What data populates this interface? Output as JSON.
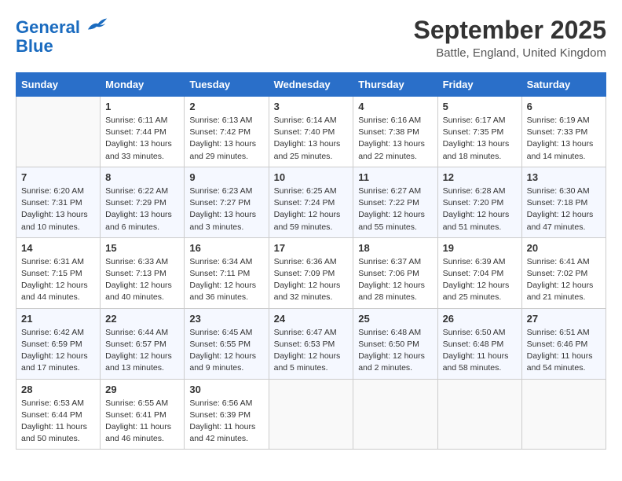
{
  "header": {
    "logo_line1": "General",
    "logo_line2": "Blue",
    "month": "September 2025",
    "location": "Battle, England, United Kingdom"
  },
  "days_of_week": [
    "Sunday",
    "Monday",
    "Tuesday",
    "Wednesday",
    "Thursday",
    "Friday",
    "Saturday"
  ],
  "weeks": [
    [
      {
        "day": "",
        "sunrise": "",
        "sunset": "",
        "daylight": ""
      },
      {
        "day": "1",
        "sunrise": "6:11 AM",
        "sunset": "7:44 PM",
        "daylight": "13 hours and 33 minutes."
      },
      {
        "day": "2",
        "sunrise": "6:13 AM",
        "sunset": "7:42 PM",
        "daylight": "13 hours and 29 minutes."
      },
      {
        "day": "3",
        "sunrise": "6:14 AM",
        "sunset": "7:40 PM",
        "daylight": "13 hours and 25 minutes."
      },
      {
        "day": "4",
        "sunrise": "6:16 AM",
        "sunset": "7:38 PM",
        "daylight": "13 hours and 22 minutes."
      },
      {
        "day": "5",
        "sunrise": "6:17 AM",
        "sunset": "7:35 PM",
        "daylight": "13 hours and 18 minutes."
      },
      {
        "day": "6",
        "sunrise": "6:19 AM",
        "sunset": "7:33 PM",
        "daylight": "13 hours and 14 minutes."
      }
    ],
    [
      {
        "day": "7",
        "sunrise": "6:20 AM",
        "sunset": "7:31 PM",
        "daylight": "13 hours and 10 minutes."
      },
      {
        "day": "8",
        "sunrise": "6:22 AM",
        "sunset": "7:29 PM",
        "daylight": "13 hours and 6 minutes."
      },
      {
        "day": "9",
        "sunrise": "6:23 AM",
        "sunset": "7:27 PM",
        "daylight": "13 hours and 3 minutes."
      },
      {
        "day": "10",
        "sunrise": "6:25 AM",
        "sunset": "7:24 PM",
        "daylight": "12 hours and 59 minutes."
      },
      {
        "day": "11",
        "sunrise": "6:27 AM",
        "sunset": "7:22 PM",
        "daylight": "12 hours and 55 minutes."
      },
      {
        "day": "12",
        "sunrise": "6:28 AM",
        "sunset": "7:20 PM",
        "daylight": "12 hours and 51 minutes."
      },
      {
        "day": "13",
        "sunrise": "6:30 AM",
        "sunset": "7:18 PM",
        "daylight": "12 hours and 47 minutes."
      }
    ],
    [
      {
        "day": "14",
        "sunrise": "6:31 AM",
        "sunset": "7:15 PM",
        "daylight": "12 hours and 44 minutes."
      },
      {
        "day": "15",
        "sunrise": "6:33 AM",
        "sunset": "7:13 PM",
        "daylight": "12 hours and 40 minutes."
      },
      {
        "day": "16",
        "sunrise": "6:34 AM",
        "sunset": "7:11 PM",
        "daylight": "12 hours and 36 minutes."
      },
      {
        "day": "17",
        "sunrise": "6:36 AM",
        "sunset": "7:09 PM",
        "daylight": "12 hours and 32 minutes."
      },
      {
        "day": "18",
        "sunrise": "6:37 AM",
        "sunset": "7:06 PM",
        "daylight": "12 hours and 28 minutes."
      },
      {
        "day": "19",
        "sunrise": "6:39 AM",
        "sunset": "7:04 PM",
        "daylight": "12 hours and 25 minutes."
      },
      {
        "day": "20",
        "sunrise": "6:41 AM",
        "sunset": "7:02 PM",
        "daylight": "12 hours and 21 minutes."
      }
    ],
    [
      {
        "day": "21",
        "sunrise": "6:42 AM",
        "sunset": "6:59 PM",
        "daylight": "12 hours and 17 minutes."
      },
      {
        "day": "22",
        "sunrise": "6:44 AM",
        "sunset": "6:57 PM",
        "daylight": "12 hours and 13 minutes."
      },
      {
        "day": "23",
        "sunrise": "6:45 AM",
        "sunset": "6:55 PM",
        "daylight": "12 hours and 9 minutes."
      },
      {
        "day": "24",
        "sunrise": "6:47 AM",
        "sunset": "6:53 PM",
        "daylight": "12 hours and 5 minutes."
      },
      {
        "day": "25",
        "sunrise": "6:48 AM",
        "sunset": "6:50 PM",
        "daylight": "12 hours and 2 minutes."
      },
      {
        "day": "26",
        "sunrise": "6:50 AM",
        "sunset": "6:48 PM",
        "daylight": "11 hours and 58 minutes."
      },
      {
        "day": "27",
        "sunrise": "6:51 AM",
        "sunset": "6:46 PM",
        "daylight": "11 hours and 54 minutes."
      }
    ],
    [
      {
        "day": "28",
        "sunrise": "6:53 AM",
        "sunset": "6:44 PM",
        "daylight": "11 hours and 50 minutes."
      },
      {
        "day": "29",
        "sunrise": "6:55 AM",
        "sunset": "6:41 PM",
        "daylight": "11 hours and 46 minutes."
      },
      {
        "day": "30",
        "sunrise": "6:56 AM",
        "sunset": "6:39 PM",
        "daylight": "11 hours and 42 minutes."
      },
      {
        "day": "",
        "sunrise": "",
        "sunset": "",
        "daylight": ""
      },
      {
        "day": "",
        "sunrise": "",
        "sunset": "",
        "daylight": ""
      },
      {
        "day": "",
        "sunrise": "",
        "sunset": "",
        "daylight": ""
      },
      {
        "day": "",
        "sunrise": "",
        "sunset": "",
        "daylight": ""
      }
    ]
  ]
}
